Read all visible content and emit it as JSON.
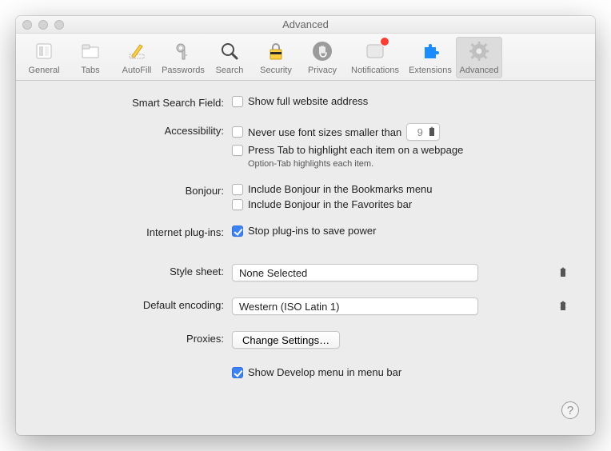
{
  "window": {
    "title": "Advanced"
  },
  "toolbar": {
    "items": [
      {
        "label": "General"
      },
      {
        "label": "Tabs"
      },
      {
        "label": "AutoFill"
      },
      {
        "label": "Passwords"
      },
      {
        "label": "Search"
      },
      {
        "label": "Security"
      },
      {
        "label": "Privacy"
      },
      {
        "label": "Notifications",
        "badge": true
      },
      {
        "label": "Extensions"
      },
      {
        "label": "Advanced",
        "selected": true
      }
    ]
  },
  "form": {
    "smart_search": {
      "label": "Smart Search Field:",
      "cb1": "Show full website address",
      "cb1_checked": false
    },
    "accessibility": {
      "label": "Accessibility:",
      "cb1": "Never use font sizes smaller than",
      "cb1_checked": false,
      "font_value": "9",
      "cb2": "Press Tab to highlight each item on a webpage",
      "cb2_checked": false,
      "hint": "Option-Tab highlights each item."
    },
    "bonjour": {
      "label": "Bonjour:",
      "cb1": "Include Bonjour in the Bookmarks menu",
      "cb1_checked": false,
      "cb2": "Include Bonjour in the Favorites bar",
      "cb2_checked": false
    },
    "plugins": {
      "label": "Internet plug-ins:",
      "cb1": "Stop plug-ins to save power",
      "cb1_checked": true
    },
    "stylesheet": {
      "label": "Style sheet:",
      "value": "None Selected"
    },
    "encoding": {
      "label": "Default encoding:",
      "value": "Western (ISO Latin 1)"
    },
    "proxies": {
      "label": "Proxies:",
      "button": "Change Settings…"
    },
    "develop": {
      "cb1": "Show Develop menu in menu bar",
      "cb1_checked": true
    }
  },
  "help": "?"
}
